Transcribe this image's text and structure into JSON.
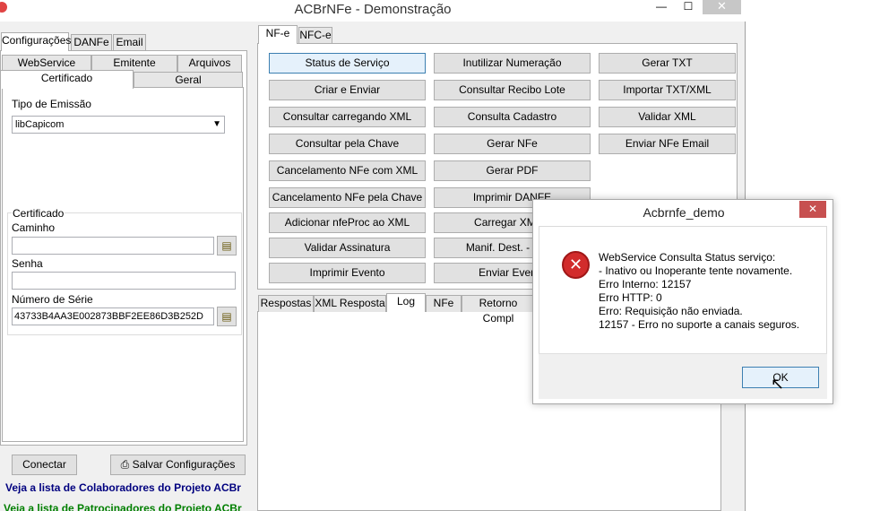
{
  "window": {
    "title": "ACBrNFe - Demonstração",
    "min": "—",
    "max": "☐",
    "close": "✕"
  },
  "left_tabs": [
    "Configurações",
    "DANFe",
    "Email"
  ],
  "sub_tabs_row1": [
    "WebService",
    "Emitente",
    "Arquivos"
  ],
  "sub_tabs_row2": [
    "Certificado",
    "Geral"
  ],
  "config": {
    "tipo_emissao_label": "Tipo de Emissão",
    "tipo_emissao_value": "libCapicom",
    "certificado_group": "Certificado",
    "caminho_label": "Caminho",
    "caminho_value": "",
    "senha_label": "Senha",
    "senha_value": "",
    "serie_label": "Número de Série",
    "serie_value": "43733B4AA3E002873BBF2EE86D3B252D"
  },
  "bottom_buttons": {
    "conectar": "Conectar",
    "salvar": "Salvar Configurações"
  },
  "links": {
    "colaboradores": "Veja a lista de Colaboradores do Projeto ACBr",
    "patrocinadores": "Veja a lista de Patrocinadores do Projeto ACBr"
  },
  "right_tabs": [
    "NF-e",
    "NFC-e"
  ],
  "buttons_col1": [
    "Status de Serviço",
    "Criar e Enviar",
    "Consultar carregando XML",
    "Consultar pela Chave",
    "Cancelamento NFe com XML",
    "Cancelamento NFe pela Chave",
    "Adicionar nfeProc ao XML",
    "Validar Assinatura",
    "Imprimir Evento"
  ],
  "buttons_col2": [
    "Inutilizar Numeração",
    "Consultar Recibo Lote",
    "Consulta Cadastro",
    "Gerar NFe",
    "Gerar PDF",
    "Imprimir DANFE",
    "Carregar XML e",
    "Manif. Dest. - Conf.",
    "Enviar Evento"
  ],
  "buttons_col3": [
    "Gerar TXT",
    "Importar TXT/XML",
    "Validar XML",
    "Enviar NFe Email"
  ],
  "result_tabs": [
    "Respostas",
    "XML Resposta",
    "Log",
    "NFe",
    "Retorno Compl"
  ],
  "dialog": {
    "title": "Acbrnfe_demo",
    "close": "✕",
    "icon": "✕",
    "lines": [
      "WebService Consulta Status serviço:",
      "- Inativo ou Inoperante tente novamente.",
      "Erro Interno: 12157",
      "Erro HTTP: 0",
      "Erro: Requisição não enviada.",
      "12157 - Erro no suporte a canais seguros."
    ],
    "ok": "OK"
  },
  "colors": {
    "link_blue": "#00007f",
    "link_green": "#007f00",
    "error_red": "#d22c2c"
  }
}
